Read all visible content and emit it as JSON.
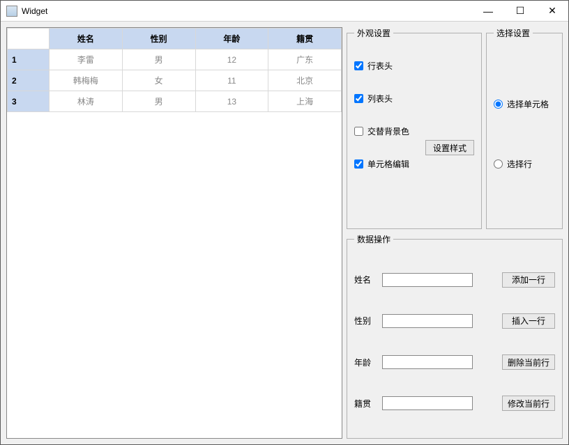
{
  "window": {
    "title": "Widget"
  },
  "table": {
    "columns": [
      "姓名",
      "性别",
      "年龄",
      "籍贯"
    ],
    "row_headers": [
      "1",
      "2",
      "3"
    ],
    "rows": [
      [
        "李雷",
        "男",
        "12",
        "广东"
      ],
      [
        "韩梅梅",
        "女",
        "11",
        "北京"
      ],
      [
        "林涛",
        "男",
        "13",
        "上海"
      ]
    ]
  },
  "appearance": {
    "legend": "外观设置",
    "row_header_label": "行表头",
    "col_header_label": "列表头",
    "alt_bg_label": "交替背景色",
    "cell_edit_label": "单元格编辑",
    "set_style_btn": "设置样式",
    "row_header_checked": true,
    "col_header_checked": true,
    "alt_bg_checked": false,
    "cell_edit_checked": true
  },
  "selection": {
    "legend": "选择设置",
    "select_cell_label": "选择单元格",
    "select_row_label": "选择行",
    "selected": "cell"
  },
  "data_ops": {
    "legend": "数据操作",
    "name_label": "姓名",
    "gender_label": "性别",
    "age_label": "年龄",
    "hometown_label": "籍贯",
    "add_row_btn": "添加一行",
    "insert_row_btn": "插入一行",
    "delete_row_btn": "删除当前行",
    "modify_row_btn": "修改当前行",
    "name_value": "",
    "gender_value": "",
    "age_value": "",
    "hometown_value": ""
  }
}
